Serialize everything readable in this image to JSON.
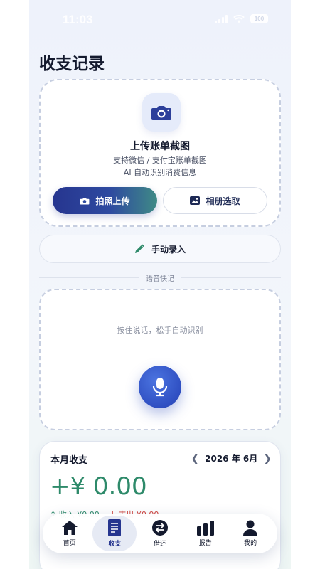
{
  "status_bar": {
    "time": "11:03",
    "battery": "100"
  },
  "page": {
    "title": "收支记录"
  },
  "upload": {
    "title": "上传账单截图",
    "subtitle_1": "支持微信 / 支付宝账单截图",
    "subtitle_2": "AI 自动识别消费信息",
    "camera_button": "拍照上传",
    "album_button": "相册选取"
  },
  "manual": {
    "label": "手动录入"
  },
  "voice": {
    "section_label": "语音快记",
    "hint": "按住说话，松手自动识别"
  },
  "month_summary": {
    "title": "本月收支",
    "period": "2026 年 6月",
    "net_amount": "+¥ 0.00",
    "income": "↑ 收入 ¥0.00",
    "expense": "↓ 支出 ¥0.00"
  },
  "tabs": [
    {
      "label": "首页",
      "icon": "home-icon"
    },
    {
      "label": "收支",
      "icon": "ledger-icon",
      "active": true
    },
    {
      "label": "借还",
      "icon": "exchange-icon"
    },
    {
      "label": "报告",
      "icon": "bar-chart-icon"
    },
    {
      "label": "我的",
      "icon": "person-icon"
    }
  ],
  "colors": {
    "accent": "#26358f",
    "income_green": "#2e8a6a",
    "expense_red": "#d0403a"
  }
}
